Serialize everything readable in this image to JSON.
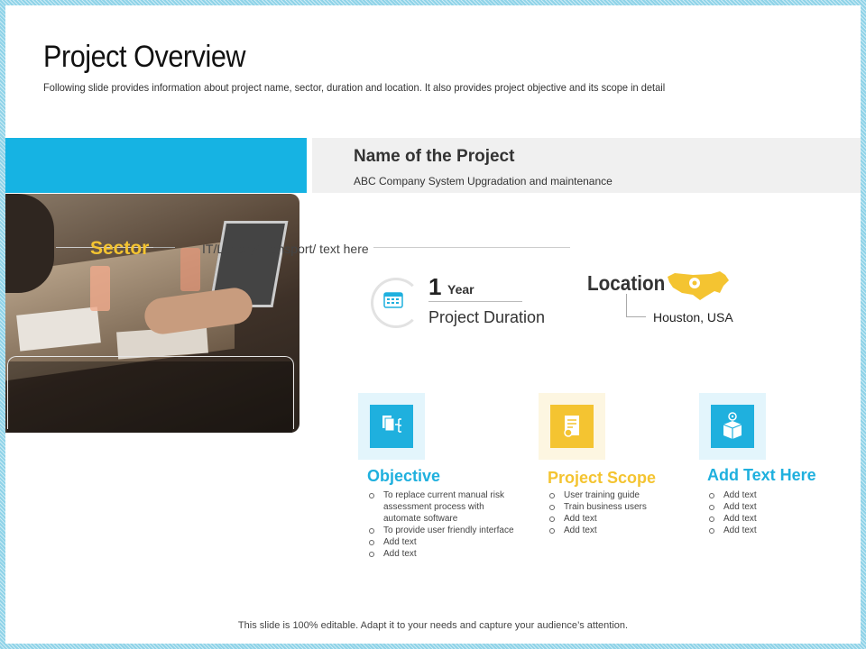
{
  "title": "Project Overview",
  "subtitle": "Following slide provides information about project name, sector, duration and location. It also provides project objective and its scope in detail",
  "project": {
    "heading": "Name of the Project",
    "description": "ABC Company System Upgradation and maintenance"
  },
  "sector": {
    "label": "Sector",
    "value": "IT/Library/Transport/ text here"
  },
  "duration": {
    "number": "1",
    "unit": "Year",
    "label": "Project Duration"
  },
  "location": {
    "label": "Location",
    "value": "Houston, USA"
  },
  "cards": [
    {
      "title": "Objective",
      "color": "#1fb0de",
      "items": [
        "To replace current manual risk assessment process with automate software",
        "To provide user friendly interface",
        "Add text",
        "Add text"
      ]
    },
    {
      "title": "Project Scope",
      "color": "#f4c431",
      "items": [
        "User training guide",
        "Train business users",
        "Add text",
        "Add text"
      ]
    },
    {
      "title": "Add Text Here",
      "color": "#1fb0de",
      "items": [
        "Add text",
        "Add text",
        "Add text",
        "Add text"
      ]
    }
  ],
  "colors": {
    "accent_blue": "#16b3e3",
    "accent_yellow": "#f4c431"
  },
  "footer": "This slide is 100% editable. Adapt it to your needs and capture your audience’s attention."
}
